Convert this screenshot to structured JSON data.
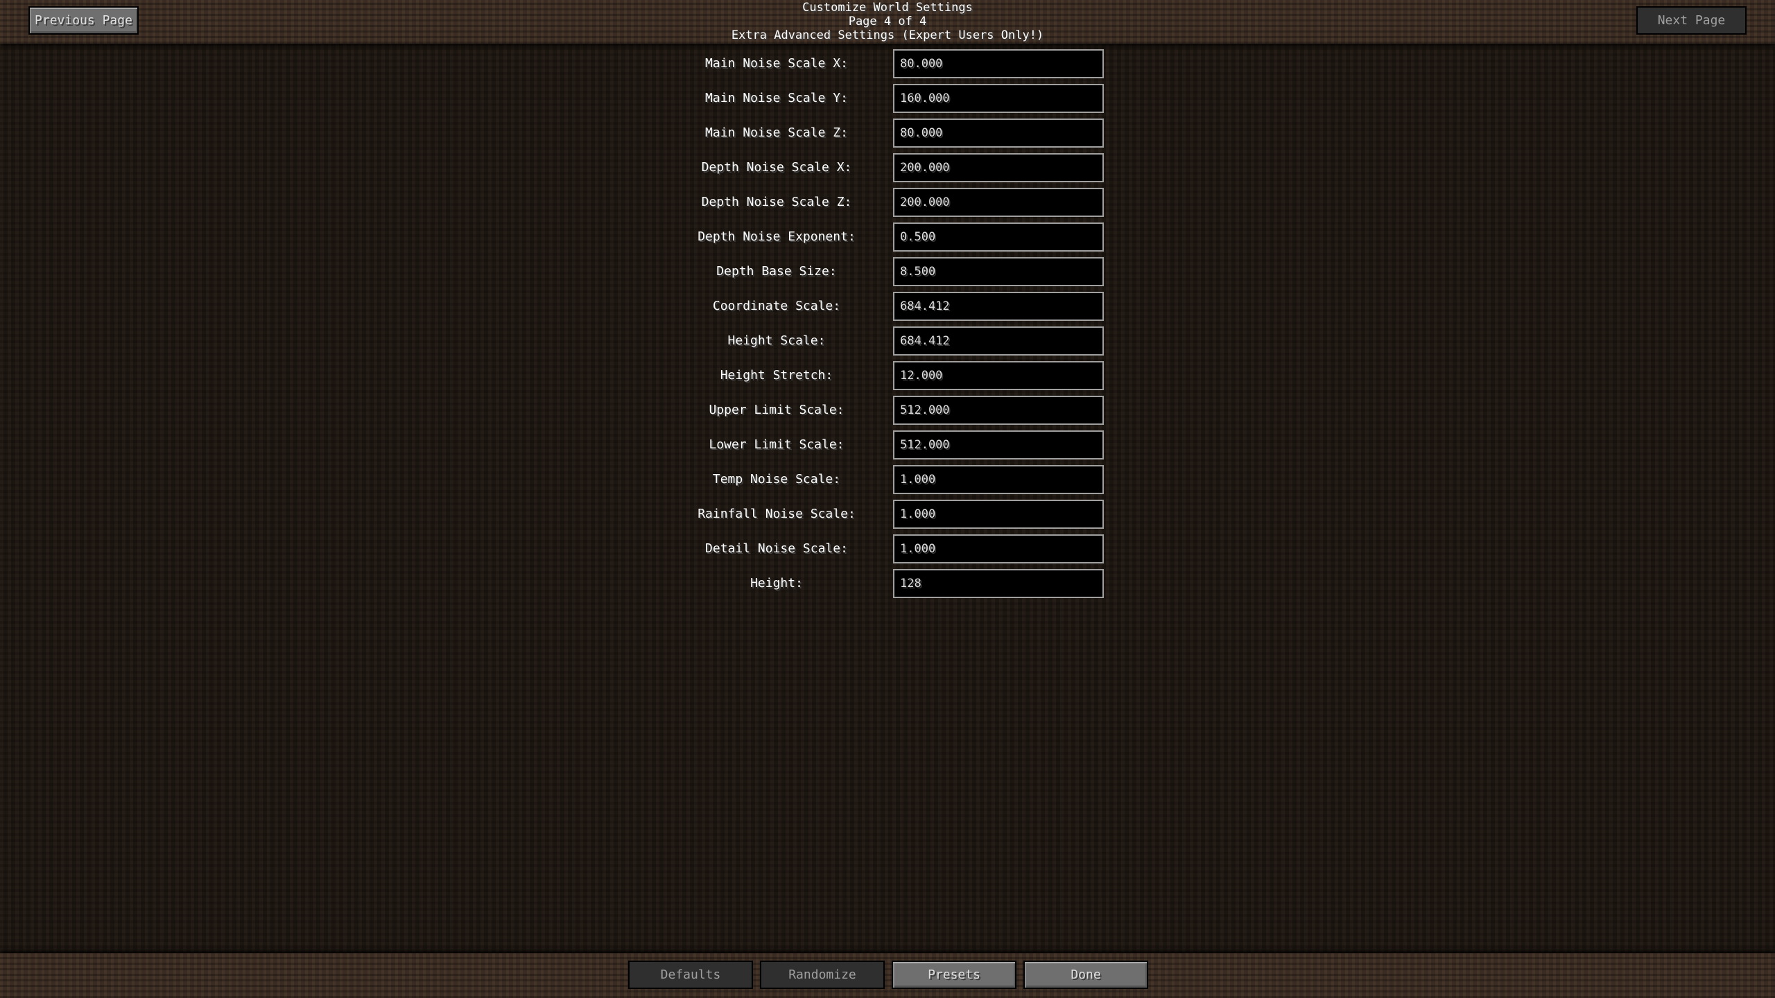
{
  "header": {
    "title": "Customize World Settings",
    "page_indicator": "Page 4 of 4",
    "subtitle": "Extra Advanced Settings (Expert Users Only!)",
    "previous_page_label": "Previous Page",
    "next_page_label": "Next Page",
    "next_page_enabled": false
  },
  "settings": [
    {
      "label": "Main Noise Scale X:",
      "value": "80.000"
    },
    {
      "label": "Main Noise Scale Y:",
      "value": "160.000"
    },
    {
      "label": "Main Noise Scale Z:",
      "value": "80.000"
    },
    {
      "label": "Depth Noise Scale X:",
      "value": "200.000"
    },
    {
      "label": "Depth Noise Scale Z:",
      "value": "200.000"
    },
    {
      "label": "Depth Noise Exponent:",
      "value": "0.500"
    },
    {
      "label": "Depth Base Size:",
      "value": "8.500"
    },
    {
      "label": "Coordinate Scale:",
      "value": "684.412"
    },
    {
      "label": "Height Scale:",
      "value": "684.412"
    },
    {
      "label": "Height Stretch:",
      "value": "12.000"
    },
    {
      "label": "Upper Limit Scale:",
      "value": "512.000"
    },
    {
      "label": "Lower Limit Scale:",
      "value": "512.000"
    },
    {
      "label": "Temp Noise Scale:",
      "value": "1.000"
    },
    {
      "label": "Rainfall Noise Scale:",
      "value": "1.000"
    },
    {
      "label": "Detail Noise Scale:",
      "value": "1.000"
    },
    {
      "label": "Height:",
      "value": "128"
    }
  ],
  "footer": {
    "defaults_label": "Defaults",
    "randomize_label": "Randomize",
    "presets_label": "Presets",
    "done_label": "Done",
    "defaults_enabled": false,
    "randomize_enabled": false,
    "presets_enabled": true,
    "done_enabled": true
  }
}
